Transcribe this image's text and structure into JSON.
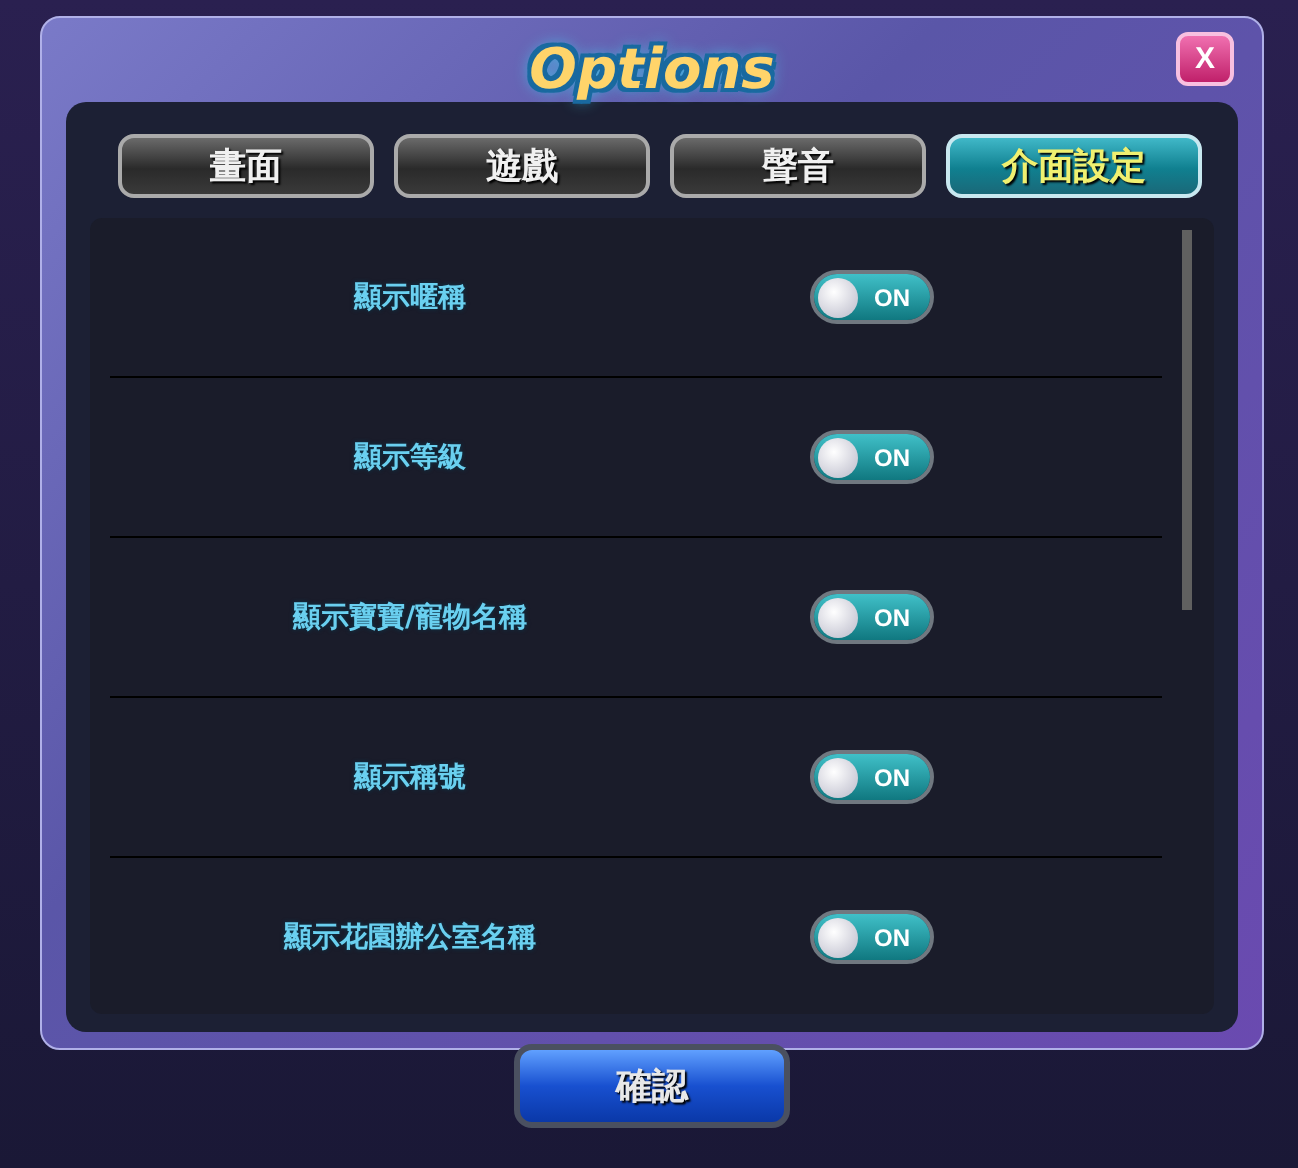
{
  "window": {
    "title": "Options",
    "close_label": "X"
  },
  "tabs": [
    {
      "label": "畫面",
      "selected": false
    },
    {
      "label": "遊戲",
      "selected": false
    },
    {
      "label": "聲音",
      "selected": false
    },
    {
      "label": "介面設定",
      "selected": true
    }
  ],
  "settings": [
    {
      "label": "顯示暱稱",
      "on": true,
      "toggle_text": "ON"
    },
    {
      "label": "顯示等級",
      "on": true,
      "toggle_text": "ON"
    },
    {
      "label": "顯示寶寶/寵物名稱",
      "on": true,
      "toggle_text": "ON"
    },
    {
      "label": "顯示稱號",
      "on": true,
      "toggle_text": "ON"
    },
    {
      "label": "顯示花園辦公室名稱",
      "on": true,
      "toggle_text": "ON"
    }
  ],
  "confirm_button": "確認"
}
